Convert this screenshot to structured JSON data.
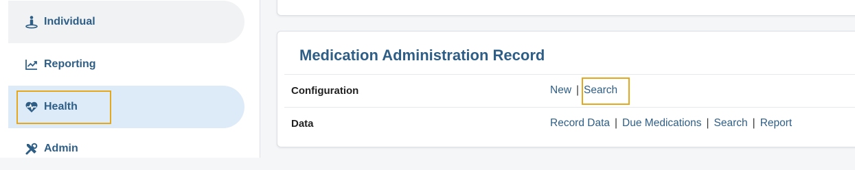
{
  "sidebar": {
    "items": [
      {
        "label": "Individual",
        "icon": "person-icon"
      },
      {
        "label": "Reporting",
        "icon": "chart-line-icon"
      },
      {
        "label": "Health",
        "icon": "heart-pulse-icon"
      },
      {
        "label": "Admin",
        "icon": "tools-icon"
      }
    ]
  },
  "card": {
    "title": "Medication Administration Record",
    "rows": [
      {
        "label": "Configuration",
        "links": [
          "New",
          "Search"
        ]
      },
      {
        "label": "Data",
        "links": [
          "Record Data",
          "Due Medications",
          "Search",
          "Report"
        ]
      }
    ]
  },
  "colors": {
    "accent": "#2e5e86",
    "highlight": "#e3a81d",
    "active_bg": "#ddebf9"
  }
}
